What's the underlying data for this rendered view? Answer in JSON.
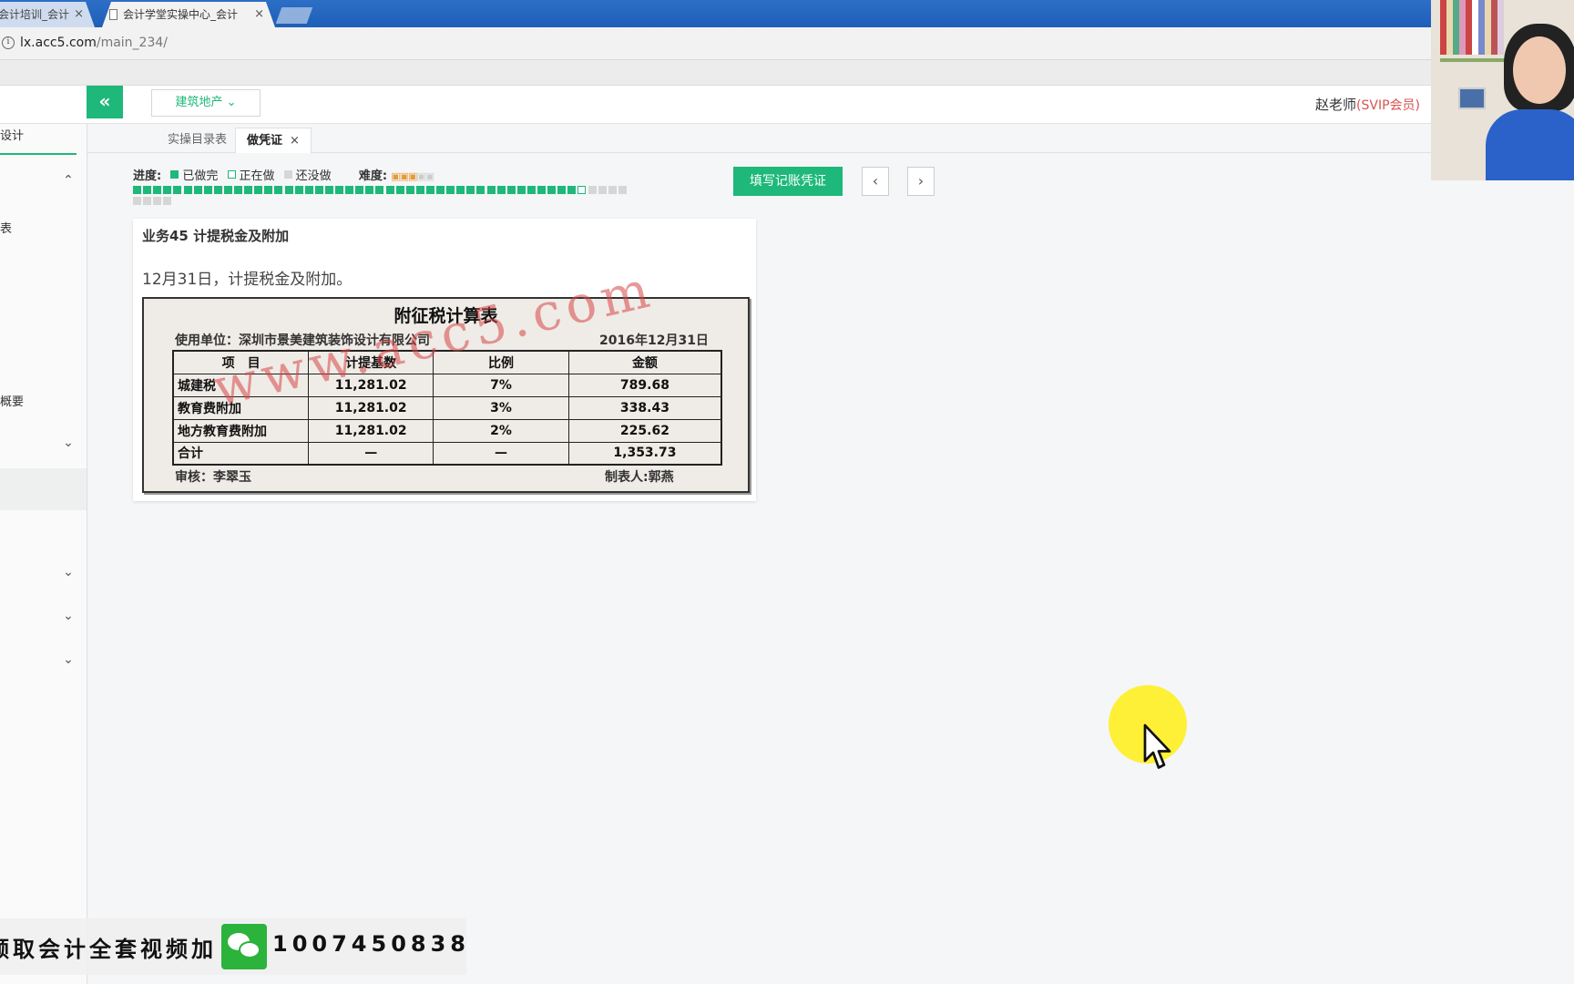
{
  "browser": {
    "tabs": [
      {
        "title": "会计培训_会计",
        "active": false
      },
      {
        "title": "会计学堂实操中心_会计",
        "active": true
      }
    ],
    "url_host": "lx.acc5.com",
    "url_path": "/main_234/"
  },
  "header": {
    "collapse_glyph": "«",
    "industry": "建筑地产 ⌄",
    "user": "赵老师",
    "user_badge": "(SVIP会员)"
  },
  "sidebar": {
    "top_label": "设计",
    "label_2": "表",
    "label_3": "概要",
    "chevron_up": "⌃",
    "chevron_down": "⌄"
  },
  "page_tabs": [
    {
      "label": "实操目录表"
    },
    {
      "label": "做凭证",
      "close": "×"
    }
  ],
  "progress": {
    "label": "进度:",
    "done": "已做完",
    "doing": "正在做",
    "todo": "还没做",
    "difficulty_label": "难度:",
    "difficulty_stars": 3,
    "difficulty_max": 5,
    "current": 45,
    "total": 53
  },
  "actions": {
    "fill_voucher": "填写记账凭证",
    "prev": "‹",
    "next": "›"
  },
  "task": {
    "title": "业务45 计提税金及附加",
    "desc": "12月31日，计提税金及附加。",
    "sheet": {
      "title": "附征税计算表",
      "unit": "使用单位：深圳市景美建筑装饰设计有限公司",
      "date": "2016年12月31日",
      "headers": [
        "项　目",
        "计提基数",
        "比例",
        "金额"
      ],
      "rows": [
        [
          "城建税",
          "11,281.02",
          "7%",
          "789.68"
        ],
        [
          "教育费附加",
          "11,281.02",
          "3%",
          "338.43"
        ],
        [
          "地方教育费附加",
          "11,281.02",
          "2%",
          "225.62"
        ],
        [
          "合计",
          "—",
          "—",
          "1,353.73"
        ]
      ],
      "review": "审核：李翠玉",
      "maker": "制表人:郭燕",
      "watermark": "www.acc5.com"
    }
  },
  "promo": {
    "text": "领取会计全套视频加",
    "phone": "1007450838"
  },
  "colors": {
    "accent": "#1eb87a",
    "vip": "#d9534f",
    "watermark": "#d64646",
    "browser_blue": "#1e5fb8"
  }
}
